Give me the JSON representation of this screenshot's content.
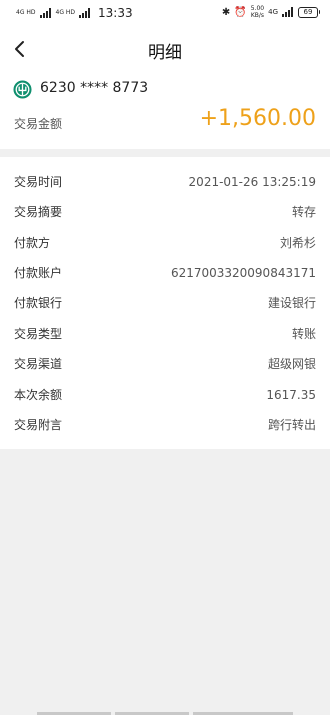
{
  "status_bar": {
    "net1": "4G HD",
    "net2": "4G HD",
    "time": "13:33",
    "speed_value": "5.00",
    "speed_unit": "KB/s",
    "net_right": "4G",
    "battery": "69"
  },
  "header": {
    "title": "明细"
  },
  "account": {
    "card_number": "6230 **** 8773",
    "amount_label": "交易金额",
    "amount_value": "+1,560.00",
    "amount_color": "#eea11a"
  },
  "details": [
    {
      "label": "交易时间",
      "value": "2021-01-26 13:25:19"
    },
    {
      "label": "交易摘要",
      "value": "转存"
    },
    {
      "label": "付款方",
      "value": "刘希杉"
    },
    {
      "label": "付款账户",
      "value": "6217003320090843171"
    },
    {
      "label": "付款银行",
      "value": "建设银行"
    },
    {
      "label": "交易类型",
      "value": "转账"
    },
    {
      "label": "交易渠道",
      "value": "超级网银"
    },
    {
      "label": "本次余额",
      "value": "1617.35"
    },
    {
      "label": "交易附言",
      "value": "跨行转出"
    }
  ]
}
